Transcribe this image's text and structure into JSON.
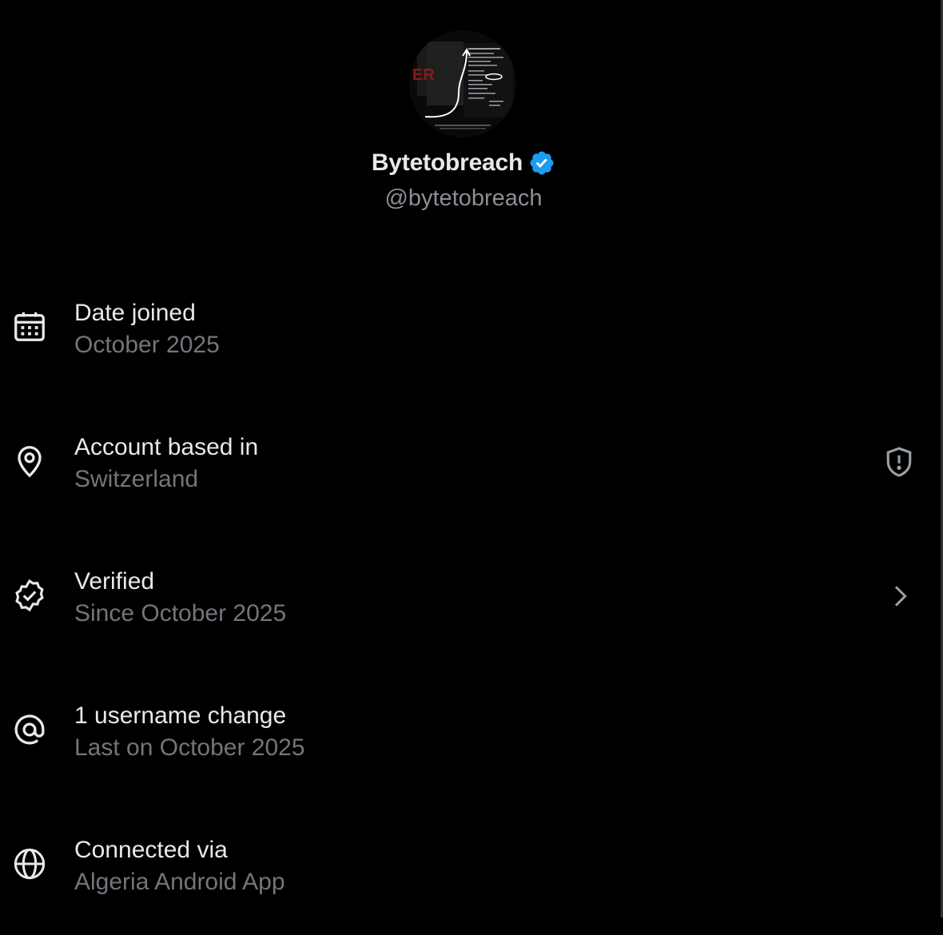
{
  "profile": {
    "display_name": "Bytetobreach",
    "handle": "@bytetobreach",
    "verified_badge_icon": "verified-badge-icon",
    "verified_color": "#1d9bf0"
  },
  "rows": [
    {
      "icon": "calendar-icon",
      "title": "Date joined",
      "subtitle": "October 2025",
      "trailing": null
    },
    {
      "icon": "location-pin-icon",
      "title": "Account based in",
      "subtitle": "Switzerland",
      "trailing": "shield-alert-icon"
    },
    {
      "icon": "verified-check-icon",
      "title": "Verified",
      "subtitle": "Since October 2025",
      "trailing": "chevron-right-icon"
    },
    {
      "icon": "at-sign-icon",
      "title": "1 username change",
      "subtitle": "Last on October 2025",
      "trailing": null
    },
    {
      "icon": "globe-icon",
      "title": "Connected via",
      "subtitle": "Algeria Android App",
      "trailing": null
    }
  ],
  "colors": {
    "background": "#000000",
    "primary_text": "#e7e9ea",
    "secondary_text": "#71767b",
    "accent": "#1d9bf0"
  }
}
